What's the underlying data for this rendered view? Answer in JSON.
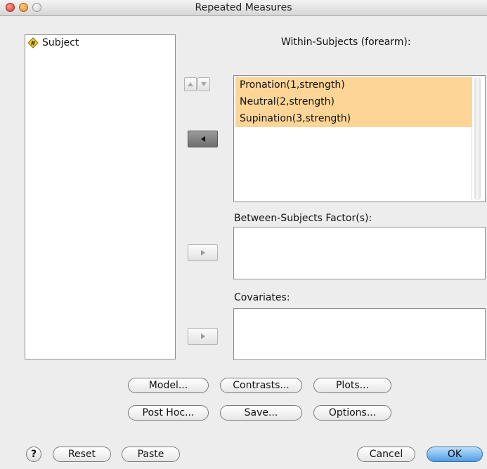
{
  "window": {
    "title": "Repeated Measures"
  },
  "source_list": {
    "items": [
      {
        "label": "Subject",
        "icon": "scale-variable-icon"
      }
    ]
  },
  "within": {
    "label": "Within-Subjects   (forearm):",
    "items": [
      "Pronation(1,strength)",
      "Neutral(2,strength)",
      "Supination(3,strength)"
    ]
  },
  "between": {
    "label": "Between-Subjects Factor(s):"
  },
  "covariates": {
    "label": "Covariates:"
  },
  "buttons": {
    "model": "Model...",
    "contrasts": "Contrasts...",
    "plots": "Plots...",
    "post_hoc": "Post Hoc...",
    "save": "Save...",
    "options": "Options...",
    "reset": "Reset",
    "paste": "Paste",
    "cancel": "Cancel",
    "ok": "OK",
    "help": "?"
  },
  "colors": {
    "selection": "#fdd596",
    "ok_button": "#4f9de8",
    "close_light": "#e0443e"
  }
}
